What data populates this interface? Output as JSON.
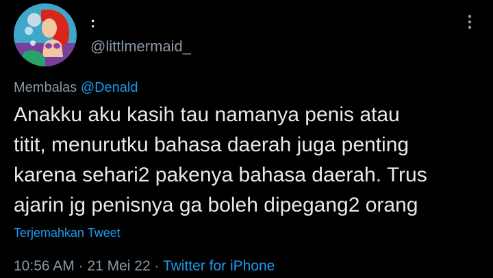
{
  "author": {
    "display_name": ":",
    "username": "@littlmermaid_",
    "avatar_icon": "profile-avatar-mermaid-icon"
  },
  "menu": {
    "icon": "more-vertical-icon"
  },
  "reply": {
    "prefix": "Membalas ",
    "mention": "@Denald"
  },
  "tweet": {
    "text": "Anakku aku kasih tau namanya penis atau\ntitit, menurutku bahasa daerah juga penting\nkarena sehari2 pakenya bahasa daerah. Trus\najarin jg penisnya ga boleh dipegang2 orang"
  },
  "translate": {
    "label": "Terjemahkan Tweet"
  },
  "meta": {
    "time": "10:56 AM",
    "separator": " · ",
    "date": "21 Mei 22",
    "source": "Twitter for iPhone"
  },
  "colors": {
    "background": "#000000",
    "text": "#e7e9ea",
    "secondary": "#8b98a5",
    "accent": "#1d9bf0"
  }
}
